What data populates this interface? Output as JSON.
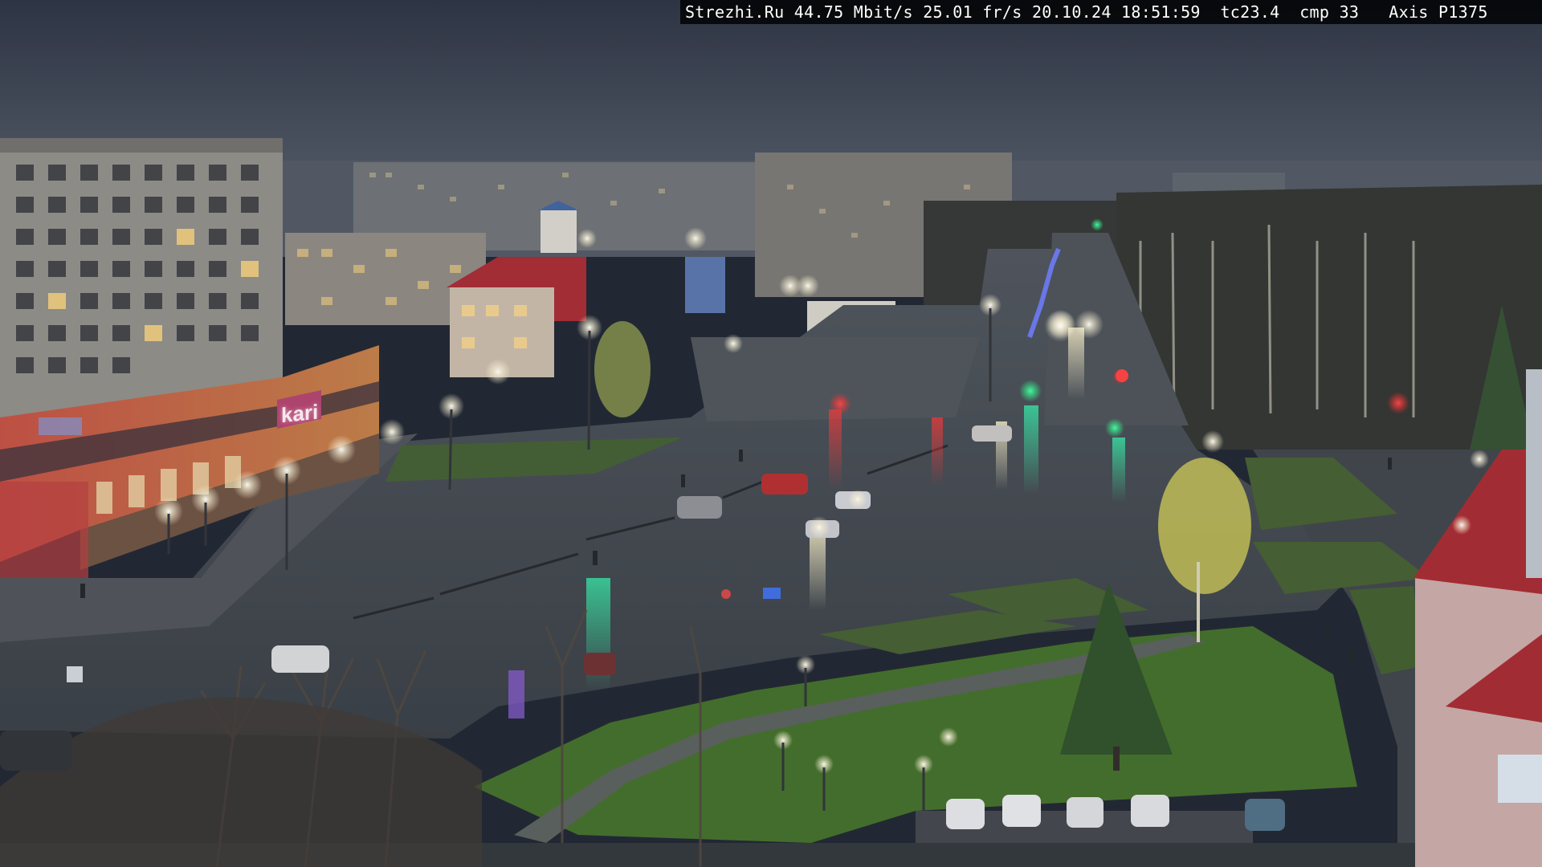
{
  "camera_overlay": {
    "site": "Strezhi.Ru",
    "bitrate": "44.75 Mbit/s",
    "framerate": "25.01 fr/s",
    "date": "20.10.24",
    "time": "18:51:59",
    "tc": "tc23.4",
    "cmp": "cmp 33",
    "camera_model": "Axis P1375"
  },
  "scene": {
    "store_sign": "kari"
  },
  "colors": {
    "sky_top": "#2a3142",
    "sky_bottom": "#4a5260",
    "road": "#3a3f46",
    "grass": "#3f5a2a",
    "building_panel": "#8c8880",
    "store_front": "#b8623e",
    "red_roof": "#a3202a",
    "lamp_glow": "#fffbe6"
  }
}
